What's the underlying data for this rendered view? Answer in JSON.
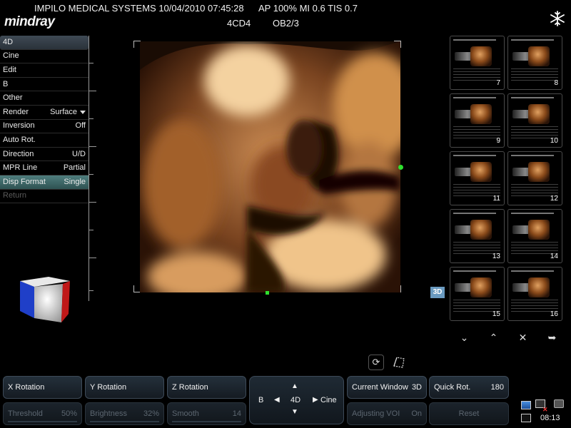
{
  "header": {
    "brand": "mindray",
    "info": "IMPILO MEDICAL SYSTEMS 10/04/2010 07:45:28",
    "ap": "AP 100% MI 0.6 TIS 0.7",
    "mode": "4CD4",
    "exam": "OB2/3"
  },
  "menu": {
    "items": [
      {
        "label": "4D",
        "value": ""
      },
      {
        "label": "Cine",
        "value": ""
      },
      {
        "label": "Edit",
        "value": ""
      },
      {
        "label": "B",
        "value": ""
      },
      {
        "label": "Other",
        "value": ""
      },
      {
        "label": "Render",
        "value": "Surface"
      },
      {
        "label": "Inversion",
        "value": "Off"
      },
      {
        "label": "Auto Rot.",
        "value": ""
      },
      {
        "label": "Direction",
        "value": "U/D"
      },
      {
        "label": "MPR Line",
        "value": "Partial"
      },
      {
        "label": "Disp Format",
        "value": "Single"
      },
      {
        "label": "Return",
        "value": ""
      }
    ]
  },
  "tag_3d": "3D",
  "thumbnails": [
    "7",
    "8",
    "9",
    "10",
    "11",
    "12",
    "13",
    "14",
    "15",
    "16"
  ],
  "controls": {
    "x_rotation": "X Rotation",
    "y_rotation": "Y Rotation",
    "z_rotation": "Z Rotation",
    "threshold_label": "Threshold",
    "threshold_value": "50%",
    "brightness_label": "Brightness",
    "brightness_value": "32%",
    "smooth_label": "Smooth",
    "smooth_value": "14",
    "pad_b": "B",
    "pad_4d": "4D",
    "pad_cine": "Cine",
    "current_window_label": "Current Window",
    "current_window_value": "3D",
    "quick_rot_label": "Quick Rot.",
    "quick_rot_value": "180",
    "adjusting_voi_label": "Adjusting VOI",
    "adjusting_voi_value": "On",
    "reset_label": "Reset"
  },
  "status": {
    "time": "08:13"
  }
}
